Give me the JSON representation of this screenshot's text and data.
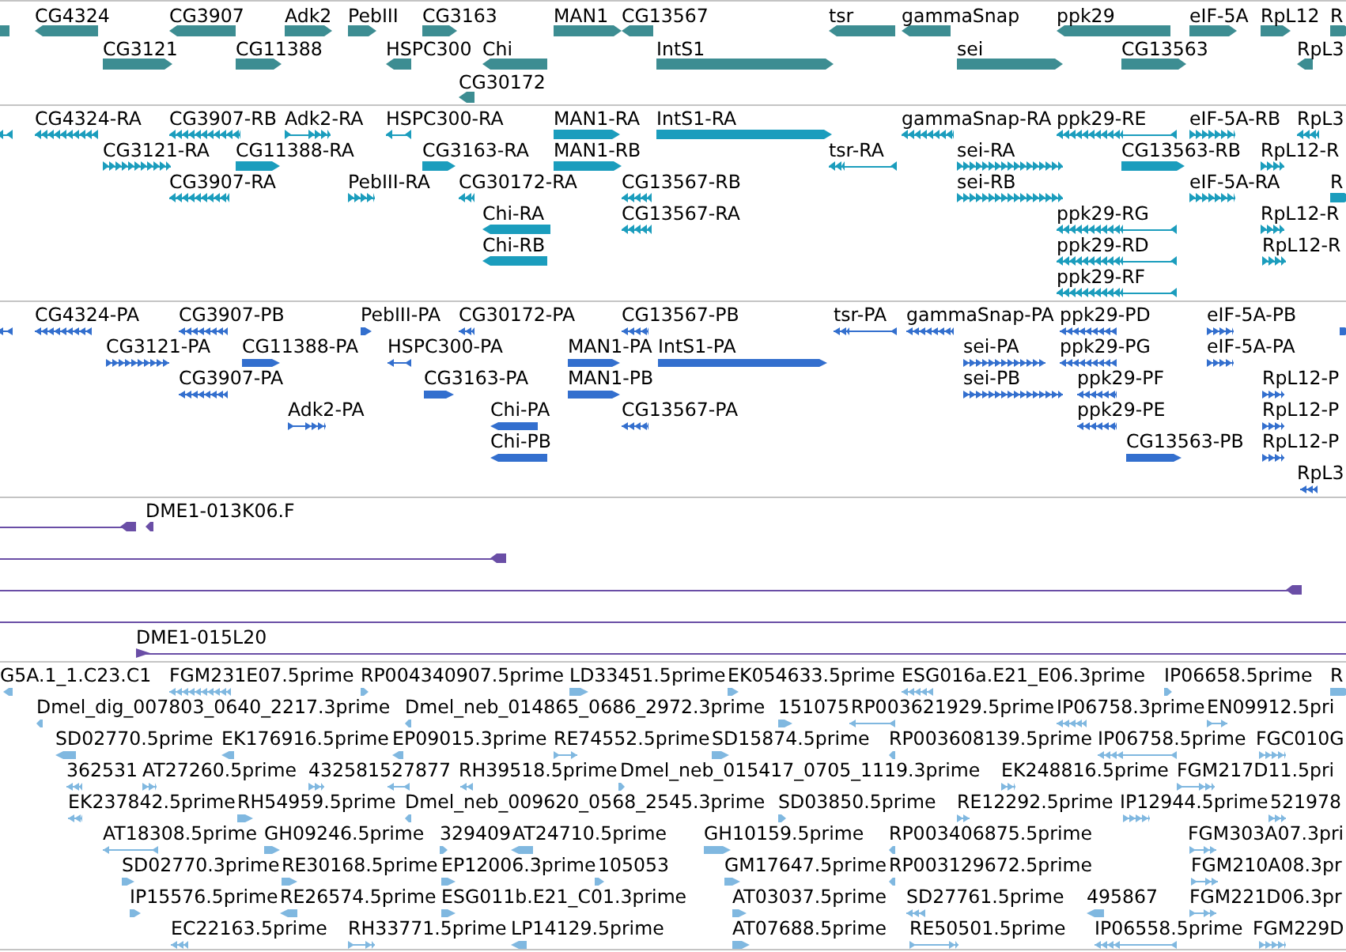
{
  "tracks": [
    {
      "color": "#3d8d92",
      "features": [
        {
          "kind": "bar"
        },
        {
          "label": "CG4324",
          "kind": "bar",
          "reverse": true
        },
        {
          "label": "CG3907",
          "kind": "bar",
          "reverse": true
        },
        {
          "label": "Adk2",
          "kind": "bar",
          "reverse": false
        },
        {
          "label": "PebIII",
          "kind": "bar",
          "reverse": false
        },
        {
          "label": "CG3163",
          "kind": "bar",
          "reverse": false
        },
        {
          "label": "MAN1",
          "kind": "bar",
          "reverse": false
        },
        {
          "label": "CG13567",
          "kind": "bar",
          "reverse": true
        },
        {
          "label": "tsr",
          "kind": "bar",
          "reverse": true
        },
        {
          "label": "gammaSnap",
          "kind": "bar",
          "reverse": true
        },
        {
          "label": "ppk29",
          "kind": "bar",
          "reverse": true
        },
        {
          "label": "eIF-5A",
          "kind": "bar",
          "reverse": false
        },
        {
          "label": "RpL12",
          "kind": "bar",
          "reverse": false
        },
        {
          "label": "R",
          "kind": "bar",
          "reverse": false
        },
        {
          "label": "CG3121",
          "kind": "bar",
          "reverse": false
        },
        {
          "label": "CG11388",
          "kind": "bar",
          "reverse": false
        },
        {
          "label": "HSPC300",
          "kind": "bar",
          "reverse": true
        },
        {
          "label": "Chi",
          "kind": "bar",
          "reverse": true
        },
        {
          "label": "IntS1",
          "kind": "bar",
          "reverse": false
        },
        {
          "label": "sei",
          "kind": "bar",
          "reverse": false
        },
        {
          "label": "CG13563",
          "kind": "bar",
          "reverse": false
        },
        {
          "label": "RpL3",
          "kind": "bar",
          "reverse": true
        },
        {
          "label": "CG30172",
          "kind": "bar",
          "reverse": true
        }
      ]
    },
    {
      "color": "#1b9dbd",
      "features": [
        {
          "kind": "intron",
          "reverse": true
        },
        {
          "label": "CG4324-RA",
          "kind": "exons",
          "reverse": true
        },
        {
          "label": "CG3907-RB",
          "kind": "exons",
          "reverse": true
        },
        {
          "label": "Adk2-RA",
          "kind": "intron",
          "reverse": false
        },
        {
          "label": "HSPC300-RA",
          "kind": "intron",
          "reverse": true
        },
        {
          "label": "MAN1-RA",
          "kind": "bar",
          "reverse": false
        },
        {
          "label": "IntS1-RA",
          "kind": "bar",
          "reverse": false
        },
        {
          "label": "gammaSnap-RA",
          "kind": "exons",
          "reverse": true
        },
        {
          "label": "ppk29-RE",
          "kind": "intron",
          "reverse": true
        },
        {
          "label": "eIF-5A-RB",
          "kind": "exons",
          "reverse": false
        },
        {
          "label": "RpL3",
          "kind": "exons",
          "reverse": true
        },
        {
          "label": "CG3121-RA",
          "kind": "exons",
          "reverse": false
        },
        {
          "label": "CG11388-RA",
          "kind": "bar",
          "reverse": false
        },
        {
          "label": "CG3163-RA",
          "kind": "bar",
          "reverse": false
        },
        {
          "label": "MAN1-RB",
          "kind": "bar",
          "reverse": false
        },
        {
          "label": "tsr-RA",
          "kind": "intron",
          "reverse": true
        },
        {
          "label": "sei-RA",
          "kind": "exons",
          "reverse": false
        },
        {
          "label": "CG13563-RB",
          "kind": "bar",
          "reverse": false
        },
        {
          "label": "RpL12-R",
          "kind": "exons",
          "reverse": false
        },
        {
          "label": "CG3907-RA",
          "kind": "exons",
          "reverse": true
        },
        {
          "label": "PebIII-RA",
          "kind": "exons",
          "reverse": false
        },
        {
          "label": "CG30172-RA",
          "kind": "exons",
          "reverse": true
        },
        {
          "label": "CG13567-RB",
          "kind": "exons",
          "reverse": true
        },
        {
          "label": "sei-RB",
          "kind": "exons",
          "reverse": false
        },
        {
          "label": "eIF-5A-RA",
          "kind": "exons",
          "reverse": false
        },
        {
          "label": "R",
          "kind": "bar",
          "reverse": false
        },
        {
          "label": "Chi-RA",
          "kind": "bar",
          "reverse": true
        },
        {
          "label": "CG13567-RA",
          "kind": "exons",
          "reverse": true
        },
        {
          "label": "ppk29-RG",
          "kind": "intron",
          "reverse": true
        },
        {
          "label": "RpL12-R",
          "kind": "exons",
          "reverse": false
        },
        {
          "label": "Chi-RB",
          "kind": "bar",
          "reverse": true
        },
        {
          "label": "ppk29-RD",
          "kind": "intron",
          "reverse": true
        },
        {
          "label": "RpL12-R",
          "kind": "exons",
          "reverse": false
        },
        {
          "label": "ppk29-RF",
          "kind": "intron",
          "reverse": true
        }
      ]
    },
    {
      "color": "#336fce",
      "features": [
        {
          "kind": "intron",
          "reverse": true
        },
        {
          "label": "CG4324-PA",
          "kind": "exons",
          "reverse": true
        },
        {
          "label": "CG3907-PB",
          "kind": "exons",
          "reverse": true
        },
        {
          "label": "PebIII-PA",
          "kind": "bar",
          "reverse": false
        },
        {
          "label": "CG30172-PA",
          "kind": "exons",
          "reverse": true
        },
        {
          "label": "CG13567-PB",
          "kind": "exons",
          "reverse": true
        },
        {
          "label": "tsr-PA",
          "kind": "intron",
          "reverse": true
        },
        {
          "label": "gammaSnap-PA",
          "kind": "exons",
          "reverse": true
        },
        {
          "label": "ppk29-PD",
          "kind": "exons",
          "reverse": true
        },
        {
          "label": "eIF-5A-PB",
          "kind": "exons",
          "reverse": false
        },
        {
          "kind": "bar",
          "reverse": false
        },
        {
          "label": "CG3121-PA",
          "kind": "exons",
          "reverse": false
        },
        {
          "label": "CG11388-PA",
          "kind": "bar",
          "reverse": false
        },
        {
          "label": "HSPC300-PA",
          "kind": "intron",
          "reverse": true
        },
        {
          "label": "MAN1-PA",
          "kind": "bar",
          "reverse": false
        },
        {
          "label": "IntS1-PA",
          "kind": "bar",
          "reverse": false
        },
        {
          "label": "sei-PA",
          "kind": "exons",
          "reverse": false
        },
        {
          "label": "ppk29-PG",
          "kind": "exons",
          "reverse": true
        },
        {
          "label": "eIF-5A-PA",
          "kind": "exons",
          "reverse": false
        },
        {
          "label": "CG3907-PA",
          "kind": "exons",
          "reverse": true
        },
        {
          "label": "CG3163-PA",
          "kind": "bar",
          "reverse": false
        },
        {
          "label": "MAN1-PB",
          "kind": "bar",
          "reverse": false
        },
        {
          "label": "sei-PB",
          "kind": "exons",
          "reverse": false
        },
        {
          "label": "ppk29-PF",
          "kind": "exons",
          "reverse": true
        },
        {
          "label": "RpL12-P",
          "kind": "exons",
          "reverse": false
        },
        {
          "label": "Adk2-PA",
          "kind": "intron",
          "reverse": false
        },
        {
          "label": "Chi-PA",
          "kind": "bar",
          "reverse": true
        },
        {
          "label": "CG13567-PA",
          "kind": "exons",
          "reverse": true
        },
        {
          "label": "ppk29-PE",
          "kind": "exons",
          "reverse": true
        },
        {
          "label": "RpL12-P",
          "kind": "exons",
          "reverse": false
        },
        {
          "label": "Chi-PB",
          "kind": "bar",
          "reverse": true
        },
        {
          "label": "CG13563-PB",
          "kind": "bar",
          "reverse": false
        },
        {
          "label": "RpL12-P",
          "kind": "exons",
          "reverse": false
        },
        {
          "label": "RpL3",
          "kind": "exons",
          "reverse": true
        }
      ]
    },
    {
      "color": "#6a4ea6",
      "features": [
        {
          "kind": "span",
          "reverse": true
        },
        {
          "label": "DME1-013K06.F",
          "kind": "bar",
          "reverse": true
        },
        {
          "kind": "span",
          "reverse": true
        },
        {
          "kind": "span",
          "reverse": true
        },
        {
          "kind": "span"
        },
        {
          "label": "DME1-015L20",
          "kind": "span",
          "reverse": false
        }
      ]
    },
    {
      "color": "#80b8e0",
      "features": [
        {
          "label": "G5A.1_1.C23.C1",
          "kind": "bar",
          "reverse": true
        },
        {
          "label": "FGM231E07.5prime",
          "kind": "exons",
          "reverse": true
        },
        {
          "label": "RP004340907.5prime",
          "kind": "bar",
          "reverse": false
        },
        {
          "label": "LD33451.5prime",
          "kind": "bar",
          "reverse": false
        },
        {
          "label": "EK054633.5prime",
          "kind": "bar",
          "reverse": false
        },
        {
          "label": "ESG016a.E21_E06.3prime",
          "kind": "exons",
          "reverse": true
        },
        {
          "label": "IP06658.5prime",
          "kind": "bar",
          "reverse": false
        },
        {
          "label": "R",
          "kind": "bar",
          "reverse": false
        },
        {
          "label": "Dmel_dig_007803_0640_2217.3prime",
          "kind": "bar",
          "reverse": true
        },
        {
          "label": "Dmel_neb_014865_0686_2972.3prime",
          "kind": "bar",
          "reverse": true
        },
        {
          "label": "151075",
          "kind": "bar",
          "reverse": false
        },
        {
          "label": "RP003621929.5prime",
          "kind": "intron",
          "reverse": true
        },
        {
          "label": "IP06758.3prime",
          "kind": "exons",
          "reverse": true
        },
        {
          "label": "EN09912.5pri",
          "kind": "intron",
          "reverse": false
        },
        {
          "label": "SD02770.5prime",
          "kind": "bar",
          "reverse": true
        },
        {
          "label": "EK176916.5prime",
          "kind": "bar",
          "reverse": true
        },
        {
          "label": "EP09015.3prime",
          "kind": "bar",
          "reverse": true
        },
        {
          "label": "RE74552.5prime",
          "kind": "intron",
          "reverse": false
        },
        {
          "label": "SD15874.5prime",
          "kind": "bar",
          "reverse": false
        },
        {
          "label": "RP003608139.5prime",
          "kind": "bar",
          "reverse": true
        },
        {
          "label": "IP06758.5prime",
          "kind": "intron",
          "reverse": true
        },
        {
          "label": "FGC010G",
          "kind": "exons",
          "reverse": false
        },
        {
          "label": "362531",
          "kind": "exons",
          "reverse": true
        },
        {
          "label": "AT27260.5prime",
          "kind": "exons",
          "reverse": false
        },
        {
          "label": "432581527877",
          "kind": "exons",
          "reverse": false
        },
        {
          "kind": "intron",
          "reverse": true
        },
        {
          "label": "RH39518.5prime",
          "kind": "exons",
          "reverse": true
        },
        {
          "label": "Dmel_neb_015417_0705_1119.3prime",
          "kind": "bar",
          "reverse": false
        },
        {
          "label": "EK248816.5prime",
          "kind": "exons",
          "reverse": false
        },
        {
          "label": "FGM217D11.5pri",
          "kind": "intron",
          "reverse": false
        },
        {
          "label": "EK237842.5prime",
          "kind": "exons",
          "reverse": true
        },
        {
          "label": "RH54959.5prime",
          "kind": "bar",
          "reverse": false
        },
        {
          "label": "Dmel_neb_009620_0568_2545.3prime",
          "kind": "bar",
          "reverse": true
        },
        {
          "label": "SD03850.5prime",
          "kind": "bar",
          "reverse": false
        },
        {
          "label": "RE12292.5prime",
          "kind": "exons",
          "reverse": false
        },
        {
          "label": "IP12944.5prime",
          "kind": "exons",
          "reverse": false
        },
        {
          "label": "521978",
          "kind": "exons",
          "reverse": false
        },
        {
          "label": "AT18308.5prime",
          "kind": "intron",
          "reverse": true
        },
        {
          "label": "GH09246.5prime",
          "kind": "bar",
          "reverse": false
        },
        {
          "label": "329409",
          "kind": "bar",
          "reverse": false
        },
        {
          "label": "AT24710.5prime",
          "kind": "bar",
          "reverse": true
        },
        {
          "label": "GH10159.5prime",
          "kind": "bar",
          "reverse": false
        },
        {
          "label": "RP003406875.5prime",
          "kind": "bar",
          "reverse": true
        },
        {
          "label": "FGM303A07.3pri",
          "kind": "intron",
          "reverse": false
        },
        {
          "label": "SD02770.3prime",
          "kind": "bar",
          "reverse": false
        },
        {
          "label": "RE30168.5prime",
          "kind": "bar",
          "reverse": false
        },
        {
          "label": "EP12006.3prime",
          "kind": "bar",
          "reverse": false
        },
        {
          "label": "105053",
          "kind": "bar",
          "reverse": false
        },
        {
          "label": "GM17647.5prime",
          "kind": "bar",
          "reverse": false
        },
        {
          "label": "RP003129672.5prime",
          "kind": "bar",
          "reverse": true
        },
        {
          "label": "FGM210A08.3pr",
          "kind": "intron",
          "reverse": false
        },
        {
          "label": "IP15576.5prime",
          "kind": "bar",
          "reverse": false
        },
        {
          "label": "RE26574.5prime",
          "kind": "bar",
          "reverse": true
        },
        {
          "label": "ESG011b.E21_C01.3prime",
          "kind": "bar",
          "reverse": false
        },
        {
          "label": "AT03037.5prime",
          "kind": "bar",
          "reverse": false
        },
        {
          "label": "SD27761.5prime",
          "kind": "exons",
          "reverse": true
        },
        {
          "label": "495867",
          "kind": "bar",
          "reverse": true
        },
        {
          "label": "FGM221D06.3pr",
          "kind": "intron",
          "reverse": false
        },
        {
          "label": "EC22163.5prime",
          "kind": "exons",
          "reverse": true
        },
        {
          "label": "RH33771.5prime",
          "kind": "intron",
          "reverse": false
        },
        {
          "label": "LP14129.5prime",
          "kind": "bar",
          "reverse": true
        },
        {
          "label": "AT07688.5prime",
          "kind": "bar",
          "reverse": false
        },
        {
          "label": "RE50501.5prime",
          "kind": "intron",
          "reverse": false
        },
        {
          "label": "IP06558.5prime",
          "kind": "intron",
          "reverse": true
        },
        {
          "label": "FGM229D",
          "kind": "exons",
          "reverse": false
        }
      ]
    }
  ]
}
